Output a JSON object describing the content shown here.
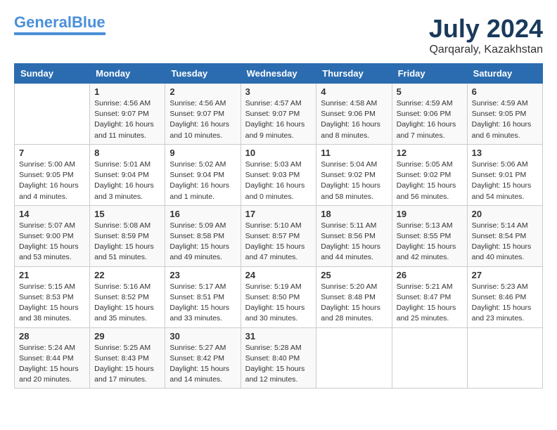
{
  "header": {
    "logo_line1": "General",
    "logo_line2": "Blue",
    "title": "July 2024",
    "subtitle": "Qarqaraly, Kazakhstan"
  },
  "weekdays": [
    "Sunday",
    "Monday",
    "Tuesday",
    "Wednesday",
    "Thursday",
    "Friday",
    "Saturday"
  ],
  "weeks": [
    [
      {
        "day": "",
        "info": ""
      },
      {
        "day": "1",
        "info": "Sunrise: 4:56 AM\nSunset: 9:07 PM\nDaylight: 16 hours\nand 11 minutes."
      },
      {
        "day": "2",
        "info": "Sunrise: 4:56 AM\nSunset: 9:07 PM\nDaylight: 16 hours\nand 10 minutes."
      },
      {
        "day": "3",
        "info": "Sunrise: 4:57 AM\nSunset: 9:07 PM\nDaylight: 16 hours\nand 9 minutes."
      },
      {
        "day": "4",
        "info": "Sunrise: 4:58 AM\nSunset: 9:06 PM\nDaylight: 16 hours\nand 8 minutes."
      },
      {
        "day": "5",
        "info": "Sunrise: 4:59 AM\nSunset: 9:06 PM\nDaylight: 16 hours\nand 7 minutes."
      },
      {
        "day": "6",
        "info": "Sunrise: 4:59 AM\nSunset: 9:05 PM\nDaylight: 16 hours\nand 6 minutes."
      }
    ],
    [
      {
        "day": "7",
        "info": "Sunrise: 5:00 AM\nSunset: 9:05 PM\nDaylight: 16 hours\nand 4 minutes."
      },
      {
        "day": "8",
        "info": "Sunrise: 5:01 AM\nSunset: 9:04 PM\nDaylight: 16 hours\nand 3 minutes."
      },
      {
        "day": "9",
        "info": "Sunrise: 5:02 AM\nSunset: 9:04 PM\nDaylight: 16 hours\nand 1 minute."
      },
      {
        "day": "10",
        "info": "Sunrise: 5:03 AM\nSunset: 9:03 PM\nDaylight: 16 hours\nand 0 minutes."
      },
      {
        "day": "11",
        "info": "Sunrise: 5:04 AM\nSunset: 9:02 PM\nDaylight: 15 hours\nand 58 minutes."
      },
      {
        "day": "12",
        "info": "Sunrise: 5:05 AM\nSunset: 9:02 PM\nDaylight: 15 hours\nand 56 minutes."
      },
      {
        "day": "13",
        "info": "Sunrise: 5:06 AM\nSunset: 9:01 PM\nDaylight: 15 hours\nand 54 minutes."
      }
    ],
    [
      {
        "day": "14",
        "info": "Sunrise: 5:07 AM\nSunset: 9:00 PM\nDaylight: 15 hours\nand 53 minutes."
      },
      {
        "day": "15",
        "info": "Sunrise: 5:08 AM\nSunset: 8:59 PM\nDaylight: 15 hours\nand 51 minutes."
      },
      {
        "day": "16",
        "info": "Sunrise: 5:09 AM\nSunset: 8:58 PM\nDaylight: 15 hours\nand 49 minutes."
      },
      {
        "day": "17",
        "info": "Sunrise: 5:10 AM\nSunset: 8:57 PM\nDaylight: 15 hours\nand 47 minutes."
      },
      {
        "day": "18",
        "info": "Sunrise: 5:11 AM\nSunset: 8:56 PM\nDaylight: 15 hours\nand 44 minutes."
      },
      {
        "day": "19",
        "info": "Sunrise: 5:13 AM\nSunset: 8:55 PM\nDaylight: 15 hours\nand 42 minutes."
      },
      {
        "day": "20",
        "info": "Sunrise: 5:14 AM\nSunset: 8:54 PM\nDaylight: 15 hours\nand 40 minutes."
      }
    ],
    [
      {
        "day": "21",
        "info": "Sunrise: 5:15 AM\nSunset: 8:53 PM\nDaylight: 15 hours\nand 38 minutes."
      },
      {
        "day": "22",
        "info": "Sunrise: 5:16 AM\nSunset: 8:52 PM\nDaylight: 15 hours\nand 35 minutes."
      },
      {
        "day": "23",
        "info": "Sunrise: 5:17 AM\nSunset: 8:51 PM\nDaylight: 15 hours\nand 33 minutes."
      },
      {
        "day": "24",
        "info": "Sunrise: 5:19 AM\nSunset: 8:50 PM\nDaylight: 15 hours\nand 30 minutes."
      },
      {
        "day": "25",
        "info": "Sunrise: 5:20 AM\nSunset: 8:48 PM\nDaylight: 15 hours\nand 28 minutes."
      },
      {
        "day": "26",
        "info": "Sunrise: 5:21 AM\nSunset: 8:47 PM\nDaylight: 15 hours\nand 25 minutes."
      },
      {
        "day": "27",
        "info": "Sunrise: 5:23 AM\nSunset: 8:46 PM\nDaylight: 15 hours\nand 23 minutes."
      }
    ],
    [
      {
        "day": "28",
        "info": "Sunrise: 5:24 AM\nSunset: 8:44 PM\nDaylight: 15 hours\nand 20 minutes."
      },
      {
        "day": "29",
        "info": "Sunrise: 5:25 AM\nSunset: 8:43 PM\nDaylight: 15 hours\nand 17 minutes."
      },
      {
        "day": "30",
        "info": "Sunrise: 5:27 AM\nSunset: 8:42 PM\nDaylight: 15 hours\nand 14 minutes."
      },
      {
        "day": "31",
        "info": "Sunrise: 5:28 AM\nSunset: 8:40 PM\nDaylight: 15 hours\nand 12 minutes."
      },
      {
        "day": "",
        "info": ""
      },
      {
        "day": "",
        "info": ""
      },
      {
        "day": "",
        "info": ""
      }
    ]
  ]
}
